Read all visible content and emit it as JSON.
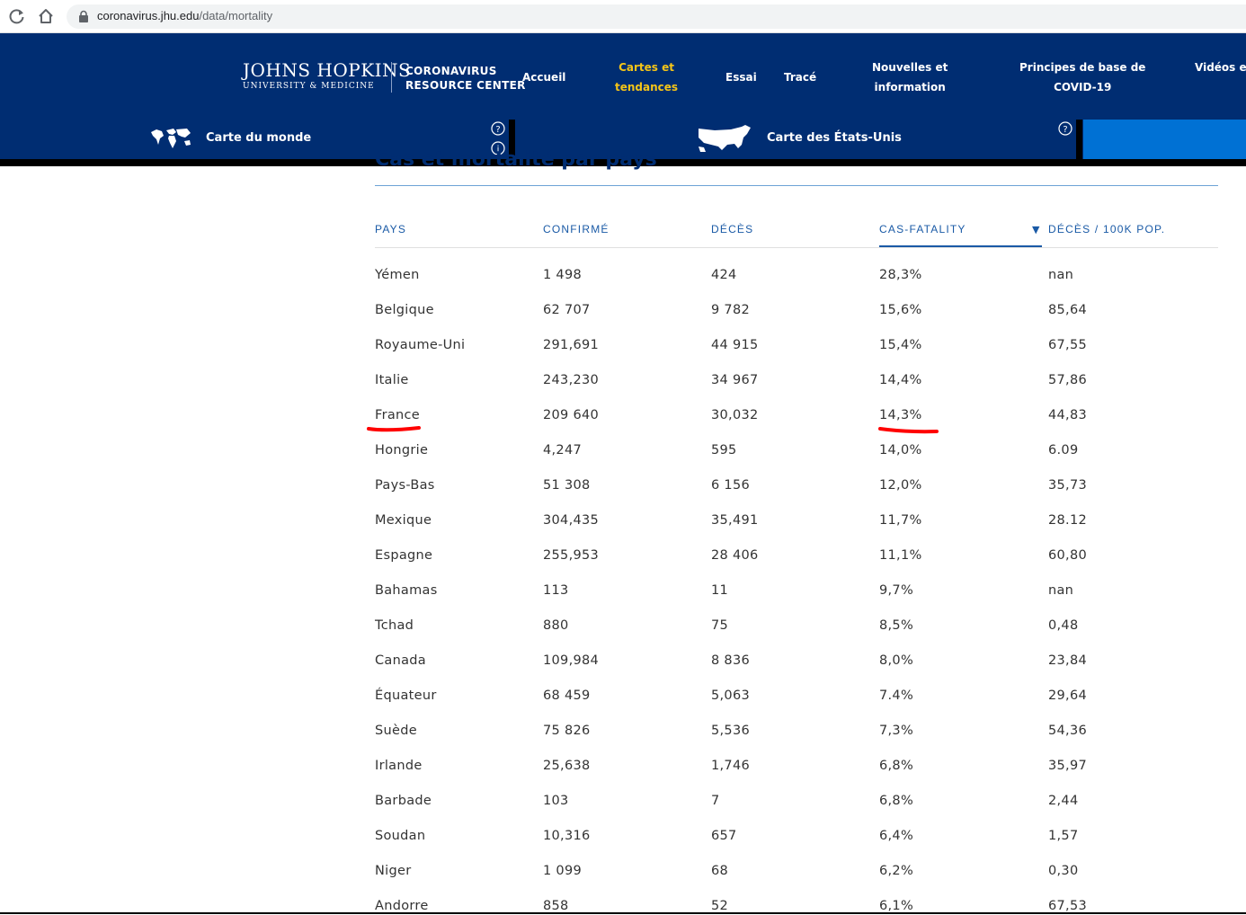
{
  "browser": {
    "url_host": "coronavirus.jhu.edu",
    "url_path": "/data/mortality"
  },
  "header": {
    "logo_main": "JOHNS HOPKINS",
    "logo_sub": "UNIVERSITY & MEDICINE",
    "center_line1": "CORONAVIRUS",
    "center_line2": "RESOURCE CENTER",
    "nav": [
      {
        "line1": "Accueil",
        "line2": ""
      },
      {
        "line1": "Cartes et",
        "line2": "tendances",
        "active": true
      },
      {
        "line1": "Essai",
        "line2": ""
      },
      {
        "line1": "Tracé",
        "line2": ""
      },
      {
        "line1": "Nouvelles et",
        "line2": "information"
      },
      {
        "line1": "Principes de base de",
        "line2": "COVID-19"
      },
      {
        "line1": "Vidéos e",
        "line2": ""
      }
    ]
  },
  "mapbar": {
    "world_label": "Carte du monde",
    "us_label": "Carte des États-Unis"
  },
  "table": {
    "heading_partial": "Cas et mortalité par pays",
    "columns": [
      "PAYS",
      "CONFIRMÉ",
      "DÉCÈS",
      "CAS-FATALITY",
      "DÉCÈS / 100K POP."
    ],
    "sort_indicator": "▼",
    "rows": [
      [
        "Yémen",
        "1 498",
        "424",
        "28,3%",
        "nan"
      ],
      [
        "Belgique",
        "62 707",
        "9 782",
        "15,6%",
        "85,64"
      ],
      [
        "Royaume-Uni",
        "291,691",
        "44 915",
        "15,4%",
        "67,55"
      ],
      [
        "Italie",
        "243,230",
        "34 967",
        "14,4%",
        "57,86"
      ],
      [
        "France",
        "209 640",
        "30,032",
        "14,3%",
        "44,83"
      ],
      [
        "Hongrie",
        "4,247",
        "595",
        "14,0%",
        "6.09"
      ],
      [
        "Pays-Bas",
        "51 308",
        "6 156",
        "12,0%",
        "35,73"
      ],
      [
        "Mexique",
        "304,435",
        "35,491",
        "11,7%",
        "28.12"
      ],
      [
        "Espagne",
        "255,953",
        "28 406",
        "11,1%",
        "60,80"
      ],
      [
        "Bahamas",
        "113",
        "11",
        "9,7%",
        "nan"
      ],
      [
        "Tchad",
        "880",
        "75",
        "8,5%",
        "0,48"
      ],
      [
        "Canada",
        "109,984",
        "8 836",
        "8,0%",
        "23,84"
      ],
      [
        "Équateur",
        "68 459",
        "5,063",
        "7.4%",
        "29,64"
      ],
      [
        "Suède",
        "75 826",
        "5,536",
        "7,3%",
        "54,36"
      ],
      [
        "Irlande",
        "25,638",
        "1,746",
        "6,8%",
        "35,97"
      ],
      [
        "Barbade",
        "103",
        "7",
        "6,8%",
        "2,44"
      ],
      [
        "Soudan",
        "10,316",
        "657",
        "6,4%",
        "1,57"
      ],
      [
        "Niger",
        "1 099",
        "68",
        "6,2%",
        "0,30"
      ],
      [
        "Andorre",
        "858",
        "52",
        "6,1%",
        "67,53"
      ]
    ]
  },
  "colors": {
    "navy": "#002d72",
    "accent_blue": "#0071d4",
    "active_nav": "#f5c518",
    "header_text": "#1a5aa6",
    "annotation_red": "#ff0000"
  }
}
